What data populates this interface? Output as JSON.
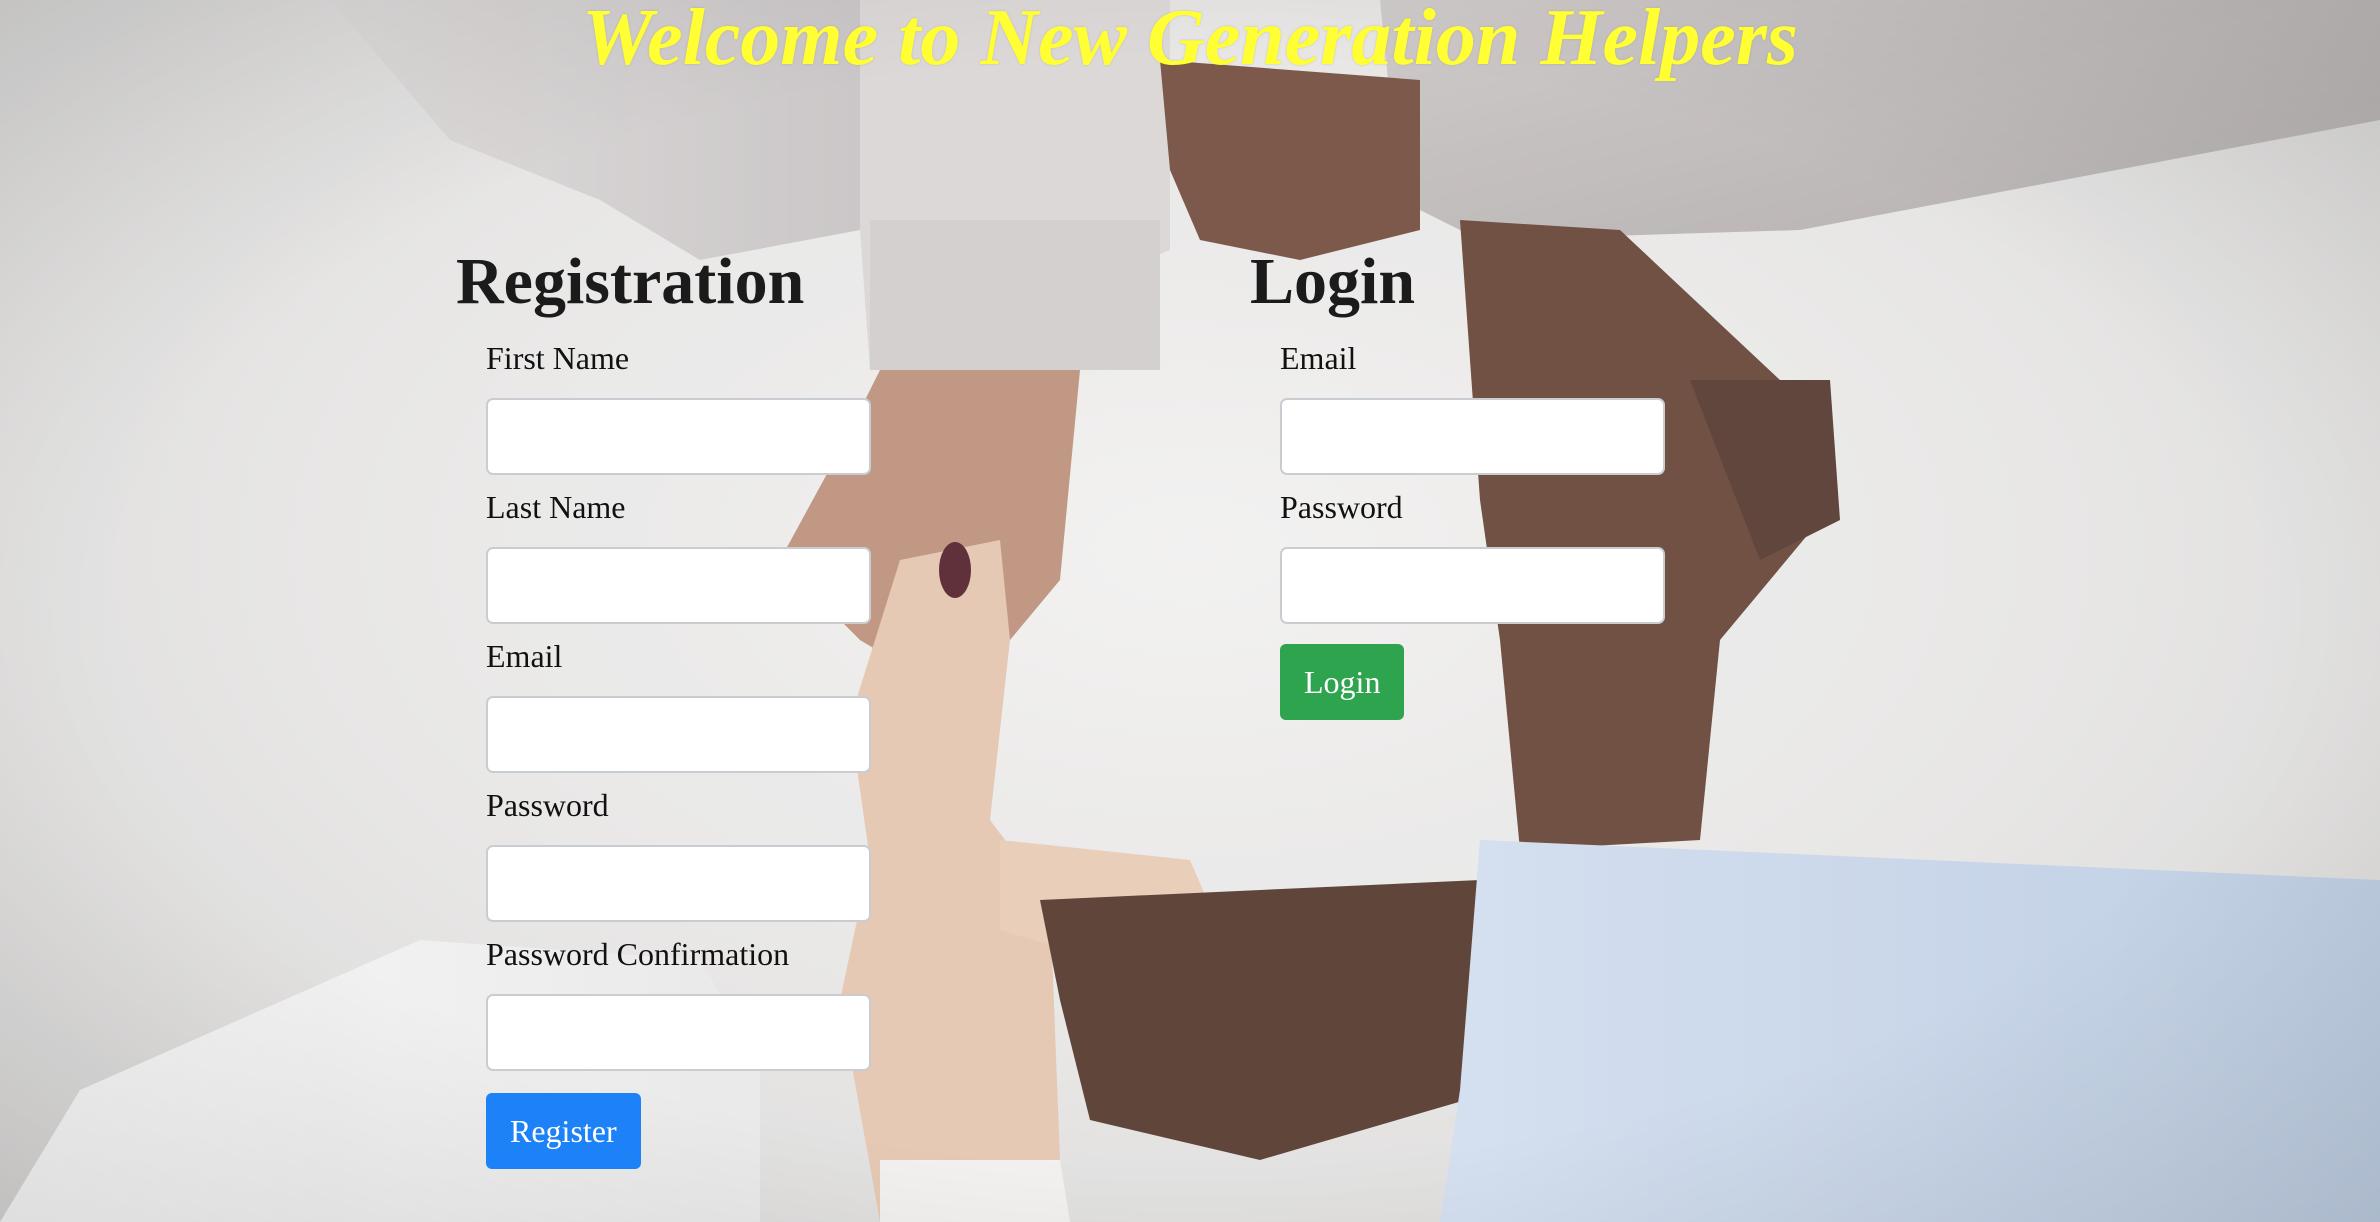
{
  "page": {
    "title": "Welcome to New Generation Helpers",
    "title_color": "#ffff33",
    "background_image": "four diverse hands interlocking at the wrists on a light grey backdrop"
  },
  "registration": {
    "heading": "Registration",
    "fields": [
      {
        "label": "First Name",
        "value": "",
        "placeholder": ""
      },
      {
        "label": "Last Name",
        "value": "",
        "placeholder": ""
      },
      {
        "label": "Email",
        "value": "",
        "placeholder": ""
      },
      {
        "label": "Password",
        "value": "",
        "placeholder": ""
      },
      {
        "label": "Password Confirmation",
        "value": "",
        "placeholder": ""
      }
    ],
    "submit_label": "Register",
    "submit_color": "#1d82f7"
  },
  "login": {
    "heading": "Login",
    "fields": [
      {
        "label": "Email",
        "value": "",
        "placeholder": ""
      },
      {
        "label": "Password",
        "value": "",
        "placeholder": ""
      }
    ],
    "submit_label": "Login",
    "submit_color": "#2ea44f"
  }
}
